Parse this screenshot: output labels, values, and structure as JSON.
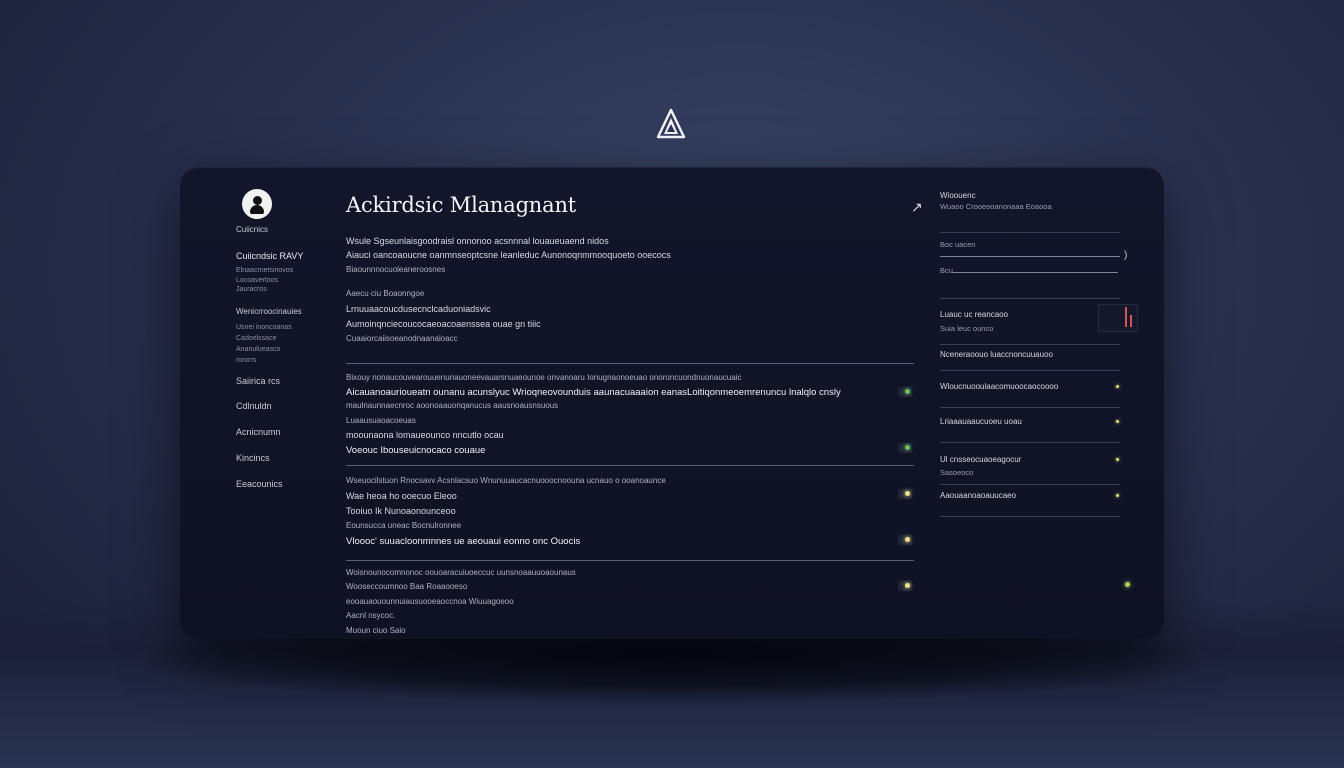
{
  "window": {
    "title": "Ackirdsic Mlanagnant",
    "corner_glyph": "↗"
  },
  "sidebar": {
    "profile_label": "Cuiicnics",
    "section_title": "Cuiicndsic RAVY",
    "section_lines": [
      "Elnaacrnetsinovos",
      "Locoavertoos",
      "Jauracros"
    ],
    "group_title": "Wenicrroocinauies",
    "group_lines": [
      "Usnei inoncoanas",
      "Cadoelssace",
      "Ananulueasco",
      "mrorrs"
    ],
    "nav_items": [
      "Saiirica rcs",
      "Cdlnuldn",
      "Acnicnumn",
      "Kincincs",
      "Eeacounics"
    ]
  },
  "main": {
    "intro_lines": [
      "Wsule Sgseunlaisgoodraisl onnonoo acsnnnal louaueuaend nidos",
      "Aiauci oancoaoucne oanmnseoptcsne leanleduc Aunonoqnmmooquoeto ooecocs",
      "Biaounnnocuoleaneroosnes"
    ],
    "block2_lines": [
      "Aaecu ciu Boaonngoe",
      "Lrnuuaacoucdusecnclcaduoniadsvic",
      "Aumoinqnciecoucocaeoacoaenssea ouae gn tiiic",
      "Cuaaiorcaiisoeanodnaanaloacc"
    ],
    "rows": [
      {
        "lines": [
          "Bixouy nonaucouvearouuenunauoneevauarsnuaeounoe onvanoaru Ionugnaonoeuao onoroncuondnuonaucuaic",
          "Aicauanoaurioueatn ounanu acunslyuc Wrioqneovounduis aaunacuaaaion eanasLoitiqonmeoemrenuncu lnalqlo cnsly",
          "maulnaunnaecnroc aoonoaauonqanucus aausnoausnsuous",
          "Luaausuaoacoeuas",
          "moounaona lomaueounco nncutlo ocau",
          "Voeouc Ibouseuicnocaco couaue"
        ],
        "icon": "green"
      },
      {
        "lines": [
          "Wseuocilstuon Rnocsavv Acsnlacsuo Wnunuuaucacnuooocnoouna ucnauo o ooanoaunce",
          "Wae heoa ho ooecuo Eleoo",
          "Tooiuo Ik Nunoaonounceoo",
          "Eounsucca uneac Bocnulronnee",
          "Vloooc' suuacloonmnnes ue aeouaui eonno onc Ouocis"
        ],
        "icon": "yellow"
      },
      {
        "lines": [
          "Woisnounocomnonoc oouoaracuiuoeccuc uunsnoaauuoaounaus",
          "Wooseccoumnoo Baa Roaaooeso",
          "eooauaouounnuiausuooeaoccnoa Wiuuagoeoo",
          "Aacnl nsycoc.",
          "Muoun ciuo Saio"
        ],
        "icon": "yellow"
      }
    ]
  },
  "panel": {
    "header_title": "Wioouenc",
    "header_sub": "Wuaoo Crooeooanonaaa Eoaooa",
    "slider1_label": "Boc uacen",
    "slider2_label": "Bcu",
    "slider_end_glyph": ")",
    "list": [
      {
        "title": "Luauc uc reancaoo",
        "sub": "Suia leuc ounco"
      },
      {
        "title": "Nceneraoouo luaccnoncuuauoo"
      },
      {
        "title": "Wloucnuooulaacomuoocaocoooo"
      },
      {
        "title": "Lriaaauaaucuoeu uoau"
      },
      {
        "title": "Ul cnsseocuaoeagocur",
        "sub": "Sasoeoco"
      },
      {
        "title": "Aaouaanoaoauucaeo"
      }
    ]
  },
  "colors": {
    "background": "#2b3352",
    "window": "#13162a",
    "accent_green": "#b7d86b",
    "accent_yellow": "#f0e28a",
    "spark_red": "#d2545c"
  }
}
